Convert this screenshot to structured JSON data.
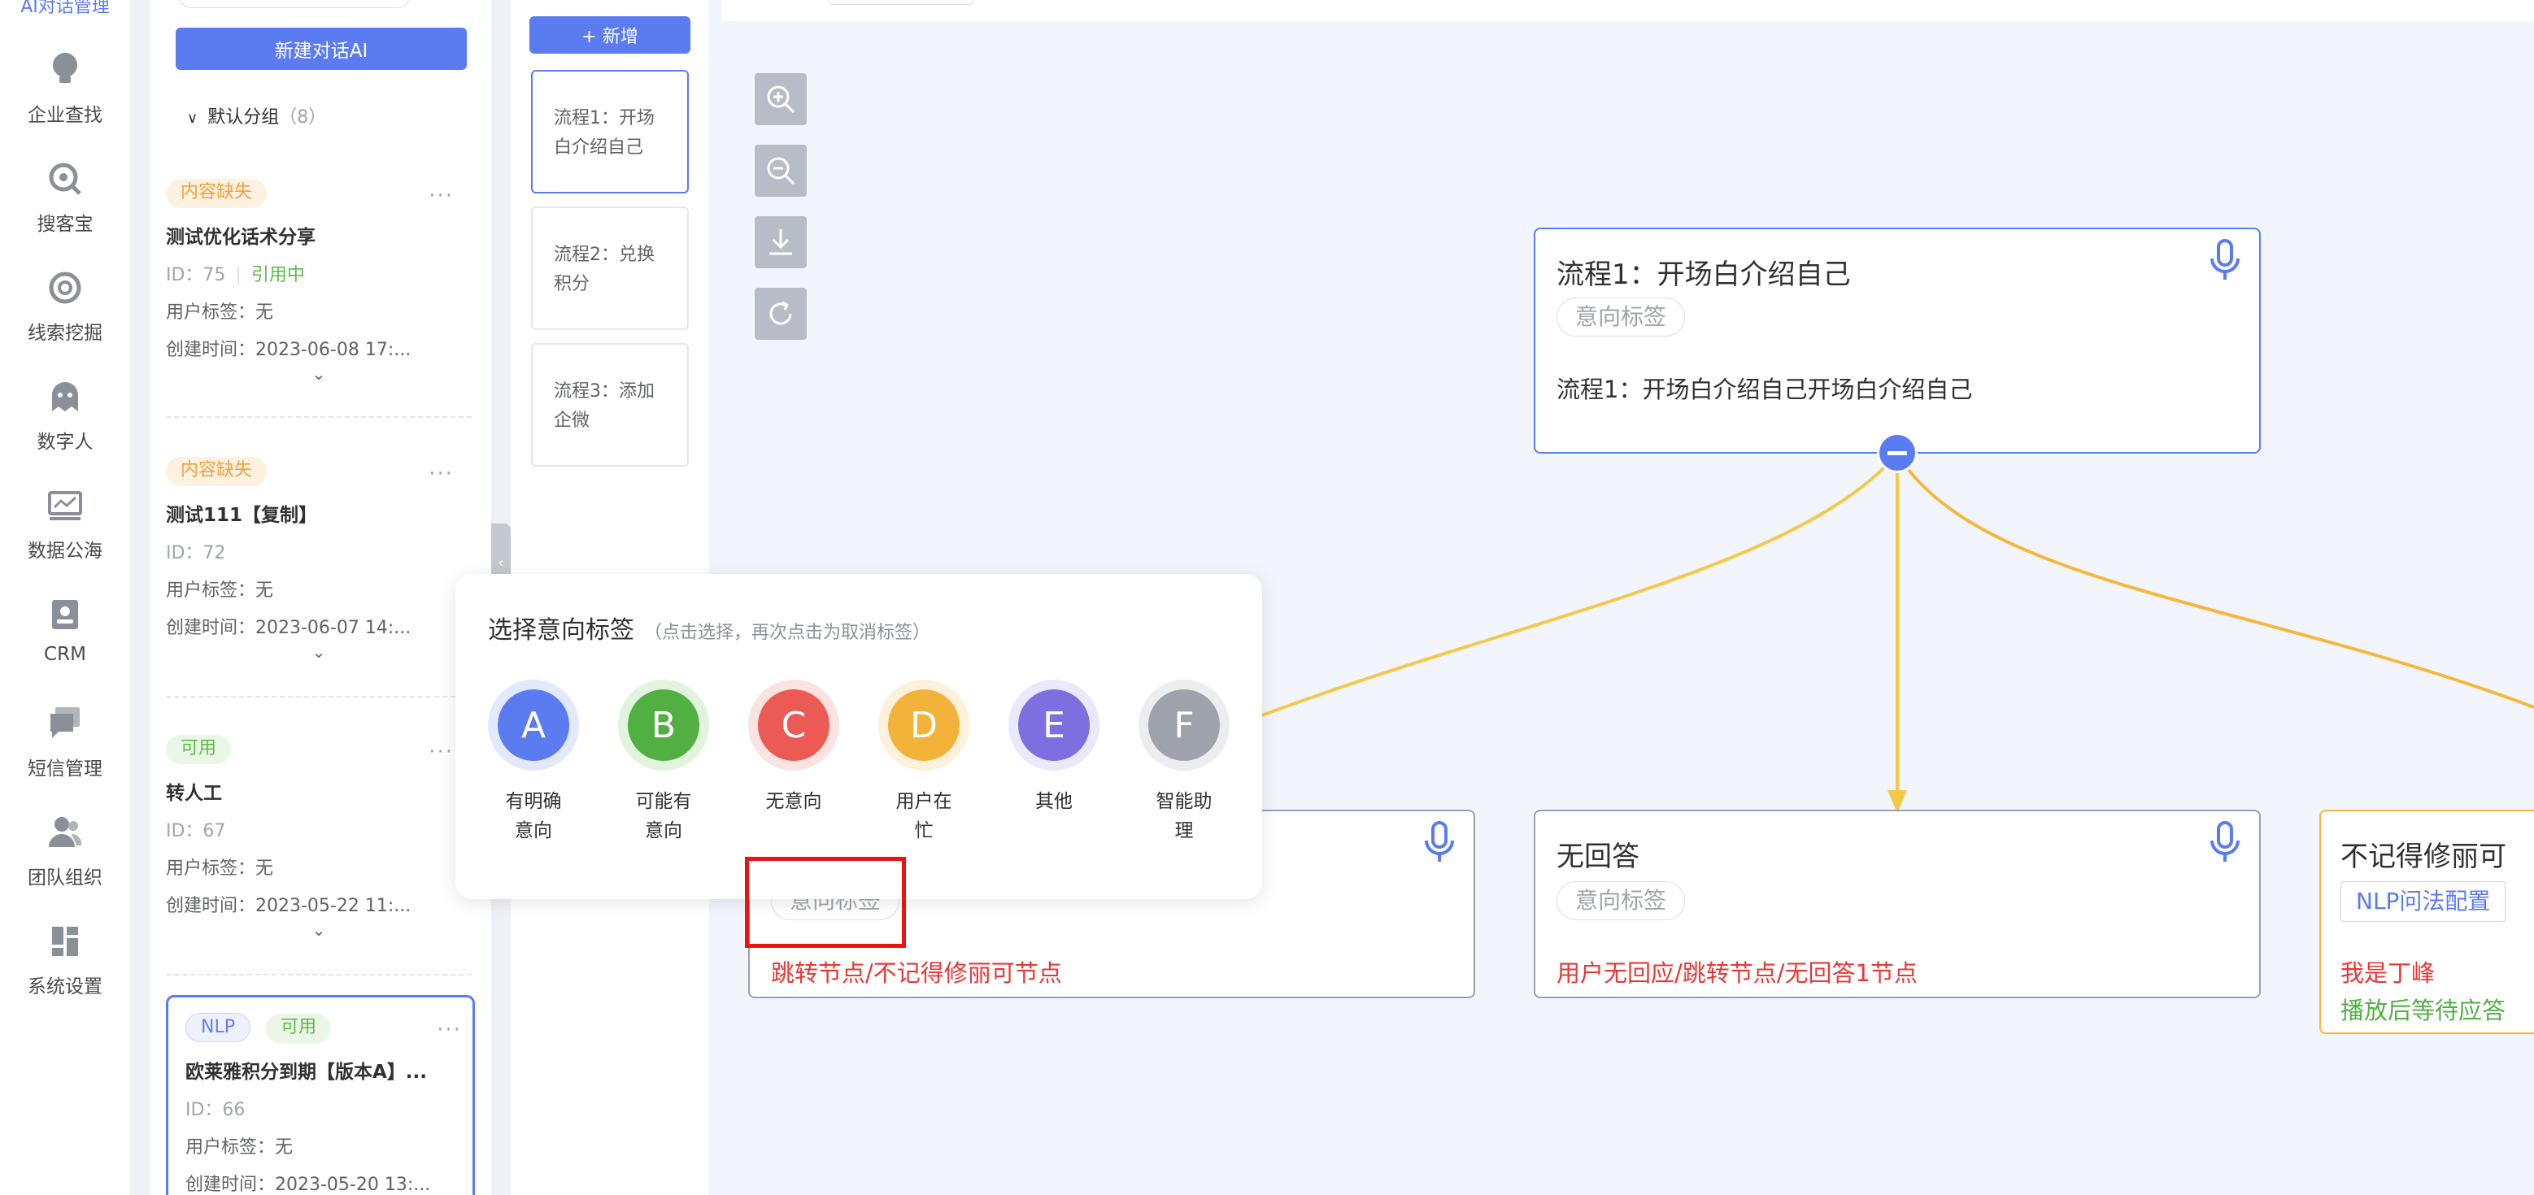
{
  "nav": {
    "top_label": "AI对话管理",
    "items": [
      {
        "label": "企业查找",
        "icon": "bulb-icon"
      },
      {
        "label": "搜客宝",
        "icon": "search-target-icon"
      },
      {
        "label": "线索挖掘",
        "icon": "target-icon"
      },
      {
        "label": "数字人",
        "icon": "ghost-icon"
      },
      {
        "label": "数据公海",
        "icon": "chart-screen-icon"
      },
      {
        "label": "CRM",
        "icon": "contact-card-icon"
      },
      {
        "label": "短信管理",
        "icon": "message-icon"
      },
      {
        "label": "团队组织",
        "icon": "team-icon"
      },
      {
        "label": "系统设置",
        "icon": "grid-icon"
      }
    ]
  },
  "groups": {
    "new_button": "新建对话AI",
    "group_name": "默认分组",
    "group_count": "（8）",
    "cards": [
      {
        "tags": [
          {
            "text": "内容缺失",
            "style": "orange"
          }
        ],
        "title": "测试优化话术分享",
        "id": "ID：75",
        "status": "引用中",
        "user_tag": "用户标签：无",
        "created": "创建时间：2023-06-08 17:..."
      },
      {
        "tags": [
          {
            "text": "内容缺失",
            "style": "orange"
          }
        ],
        "title": "测试111【复制】",
        "id": "ID：72",
        "status": "",
        "user_tag": "用户标签：无",
        "created": "创建时间：2023-06-07 14:..."
      },
      {
        "tags": [
          {
            "text": "可用",
            "style": "green"
          }
        ],
        "title": "转人工",
        "id": "ID：67",
        "status": "",
        "user_tag": "用户标签：无",
        "created": "创建时间：2023-05-22 11:..."
      },
      {
        "tags": [
          {
            "text": "NLP",
            "style": "nlp"
          },
          {
            "text": "可用",
            "style": "green"
          }
        ],
        "title": "欧莱雅积分到期【版本A】...",
        "id": "ID：66",
        "status": "",
        "user_tag": "用户标签：无",
        "created": "创建时间：2023-05-20 13:..."
      }
    ]
  },
  "flows": {
    "add_button": "+ 新增",
    "items": [
      {
        "label": "流程1：开场白介绍自己"
      },
      {
        "label": "流程2：兑换积分"
      },
      {
        "label": "流程3：添加企微"
      }
    ]
  },
  "canvas": {
    "main_node": {
      "title": "流程1：开场白介绍自己",
      "tag": "意向标签",
      "text": "流程1：开场白介绍自己开场白介绍自己"
    },
    "left_node": {
      "tag": "意向标签",
      "text": "跳转节点/不记得修丽可节点"
    },
    "mid_node": {
      "title": "无回答",
      "tag": "意向标签",
      "text": "用户无回应/跳转节点/无回答1节点"
    },
    "right_node": {
      "title": "不记得修丽可",
      "tag": "NLP问法配置",
      "line1": "我是丁峰",
      "line2": "播放后等待应答"
    }
  },
  "popup": {
    "title": "选择意向标签",
    "hint": "（点击选择，再次点击为取消标签）",
    "options": [
      {
        "letter": "A",
        "label": "有明确意向",
        "color": "#5b7bf0",
        "ring": "#e3e9fd"
      },
      {
        "letter": "B",
        "label": "可能有意向",
        "color": "#52b043",
        "ring": "#e2f3de"
      },
      {
        "letter": "C",
        "label": "无意向",
        "color": "#ec5a55",
        "ring": "#fbe3e2"
      },
      {
        "letter": "D",
        "label": "用户在忙",
        "color": "#f2b33a",
        "ring": "#fdf1dc"
      },
      {
        "letter": "E",
        "label": "其他",
        "color": "#7e6fe0",
        "ring": "#ebe8fb"
      },
      {
        "letter": "F",
        "label": "智能助理",
        "color": "#9ea2ab",
        "ring": "#ededf0"
      }
    ]
  },
  "colors": {
    "accent": "#5b7bf0",
    "connector": "#f5b83d",
    "highlight": "#e81515"
  }
}
